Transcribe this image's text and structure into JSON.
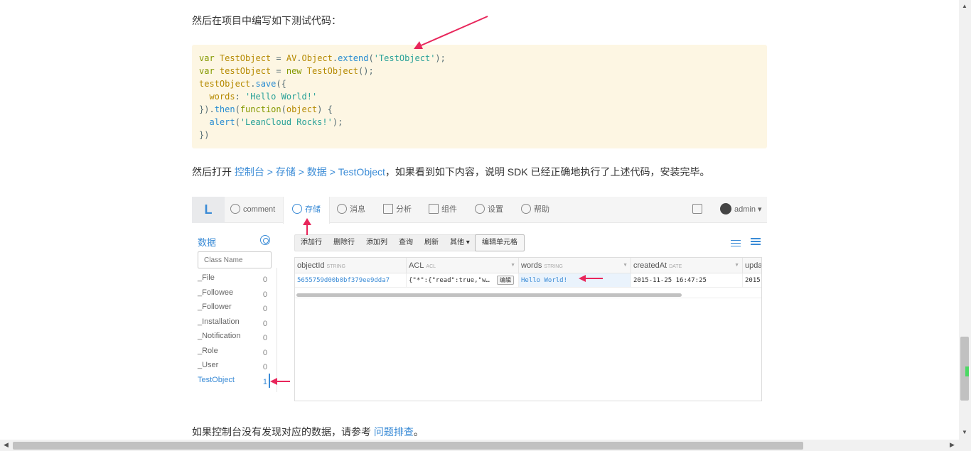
{
  "intro": "然后在项目中编写如下测试代码：",
  "code_lines": [
    [
      [
        "kw",
        "var "
      ],
      [
        "id",
        "TestObject"
      ],
      [
        "txt",
        " = "
      ],
      [
        "id",
        "AV"
      ],
      [
        "txt",
        "."
      ],
      [
        "id",
        "Object"
      ],
      [
        "txt",
        "."
      ],
      [
        "fn",
        "extend"
      ],
      [
        "txt",
        "("
      ],
      [
        "str",
        "'TestObject'"
      ],
      [
        "txt",
        ");"
      ]
    ],
    [
      [
        "kw",
        "var "
      ],
      [
        "id",
        "testObject"
      ],
      [
        "txt",
        " = "
      ],
      [
        "kw",
        "new "
      ],
      [
        "id",
        "TestObject"
      ],
      [
        "txt",
        "();"
      ]
    ],
    [
      [
        "id",
        "testObject"
      ],
      [
        "txt",
        "."
      ],
      [
        "fn",
        "save"
      ],
      [
        "txt",
        "({"
      ]
    ],
    [
      [
        "txt",
        "  "
      ],
      [
        "id",
        "words"
      ],
      [
        "txt",
        ": "
      ],
      [
        "str",
        "'Hello World!'"
      ]
    ],
    [
      [
        "txt",
        "})."
      ],
      [
        "fn",
        "then"
      ],
      [
        "txt",
        "("
      ],
      [
        "kw",
        "function"
      ],
      [
        "txt",
        "("
      ],
      [
        "id",
        "object"
      ],
      [
        "txt",
        ") {"
      ]
    ],
    [
      [
        "txt",
        "  "
      ],
      [
        "fn",
        "alert"
      ],
      [
        "txt",
        "("
      ],
      [
        "str",
        "'LeanCloud Rocks!'"
      ],
      [
        "txt",
        ");"
      ]
    ],
    [
      [
        "txt",
        "})"
      ]
    ]
  ],
  "para2": {
    "prefix": "然后打开 ",
    "link": "控制台 > 存储 > 数据 > TestObject",
    "suffix": "，如果看到如下内容，说明 SDK 已经正确地执行了上述代码，安装完毕。"
  },
  "console": {
    "logo": "L",
    "nav": {
      "comment": "comment",
      "storage": "存储",
      "message": "消息",
      "analytics": "分析",
      "components": "组件",
      "settings": "设置",
      "help": "帮助",
      "user": "admin ▾"
    },
    "sidebar": {
      "title": "数据",
      "class_placeholder": "Class Name",
      "classes": [
        {
          "name": "_File",
          "count": "0"
        },
        {
          "name": "_Followee",
          "count": "0"
        },
        {
          "name": "_Follower",
          "count": "0"
        },
        {
          "name": "_Installation",
          "count": "0"
        },
        {
          "name": "_Notification",
          "count": "0"
        },
        {
          "name": "_Role",
          "count": "0"
        },
        {
          "name": "_User",
          "count": "0"
        },
        {
          "name": "TestObject",
          "count": "1"
        }
      ]
    },
    "toolbar": {
      "add_row": "添加行",
      "delete_row": "删除行",
      "add_column": "添加列",
      "query": "查询",
      "refresh": "刷新",
      "more": "其他 ▾",
      "edit_cell": "编辑单元格"
    },
    "grid": {
      "columns": [
        {
          "name": "objectId",
          "type": "STRING"
        },
        {
          "name": "ACL",
          "type": "ACL"
        },
        {
          "name": "words",
          "type": "STRING"
        },
        {
          "name": "createdAt",
          "type": "DATE"
        },
        {
          "name": "upda",
          "type": ""
        }
      ],
      "row": {
        "objectId": "5655759d00b0bf379ee9dda7",
        "acl": "{\"*\":{\"read\":true,\"w…",
        "acl_edit": "编辑",
        "words": "Hello World!",
        "createdAt": "2015-11-25 16:47:25",
        "updatedAt": "2015"
      }
    }
  },
  "para3": {
    "prefix": "如果控制台没有发现对应的数据，请参考 ",
    "link": "问题排查",
    "suffix": "。"
  },
  "colors": {
    "link": "#3a8bd6",
    "code_bg": "#fdf6e3",
    "arrow": "#e8265b"
  },
  "icons": [
    "comment-icon",
    "cloud-upload-icon",
    "message-icon",
    "chart-icon",
    "sliders-icon",
    "gear-icon",
    "help-icon",
    "inbox-icon",
    "avatar",
    "filter-icon",
    "list-icon"
  ]
}
